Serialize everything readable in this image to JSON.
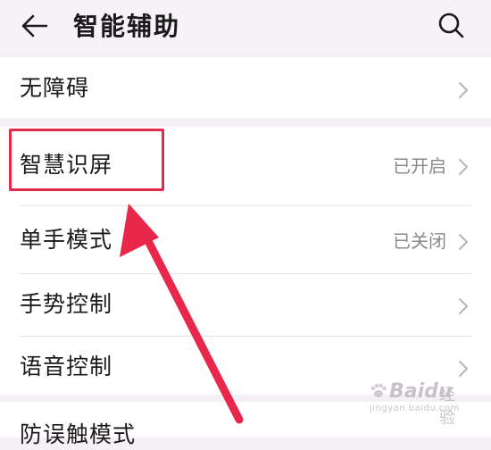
{
  "header": {
    "title": "智能辅助"
  },
  "rows": [
    {
      "label": "无障碍",
      "value": ""
    },
    {
      "label": "智慧识屏",
      "value": "已开启"
    },
    {
      "label": "单手模式",
      "value": "已关闭"
    },
    {
      "label": "手势控制",
      "value": ""
    },
    {
      "label": "语音控制",
      "value": ""
    },
    {
      "label": "防误触模式",
      "value": ""
    }
  ],
  "annotation": {
    "highlight_color": "#e8274b",
    "arrow_color": "#e8274b"
  },
  "watermark": {
    "brand": "Baidu",
    "suffix": "经验",
    "url": "jingyan.baidu.com"
  },
  "icons": {
    "back": "back-arrow-icon",
    "search": "search-icon",
    "chevron": "chevron-right-icon"
  }
}
